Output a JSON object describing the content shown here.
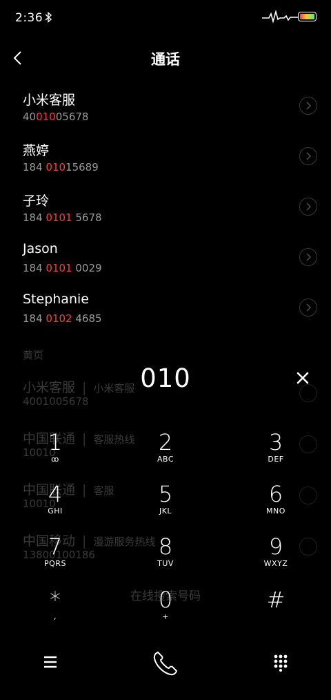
{
  "status_bar": {
    "time": "2:36"
  },
  "header": {
    "title": "通话"
  },
  "contacts": [
    {
      "name": "小米客服",
      "num_pre": "40",
      "num_hl": "010",
      "num_post": "05678"
    },
    {
      "name": "燕婷",
      "num_pre": "184 ",
      "num_hl": "010",
      "num_post": "15689"
    },
    {
      "name": "子玲",
      "num_pre": "184 ",
      "num_hl": "0101",
      "num_post": " 5678"
    },
    {
      "name": "Jason",
      "num_pre": "184 ",
      "num_hl": "0101",
      "num_post": " 0029"
    },
    {
      "name": "Stephanie",
      "num_pre": "184 ",
      "num_hl": "0102",
      "num_post": " 4685"
    }
  ],
  "yellow_pages": {
    "section_label": "黄页",
    "entries": [
      {
        "name": "小米客服",
        "sub": "小米客服",
        "number": "4001005678"
      },
      {
        "name": "中国联通",
        "sub": "客服热线",
        "number": "10010"
      },
      {
        "name": "中国联通",
        "sub": "客服",
        "number": "10010"
      },
      {
        "name": "中国移动",
        "sub": "漫游服务热线",
        "number": "13800100186"
      }
    ],
    "search_online": "在线搜索号码"
  },
  "dialer": {
    "input": "010",
    "keys": [
      {
        "digit": "1",
        "letters": "ꝏ"
      },
      {
        "digit": "2",
        "letters": "ABC"
      },
      {
        "digit": "3",
        "letters": "DEF"
      },
      {
        "digit": "4",
        "letters": "GHI"
      },
      {
        "digit": "5",
        "letters": "JKL"
      },
      {
        "digit": "6",
        "letters": "MNO"
      },
      {
        "digit": "7",
        "letters": "PQRS"
      },
      {
        "digit": "8",
        "letters": "TUV"
      },
      {
        "digit": "9",
        "letters": "WXYZ"
      },
      {
        "digit": "*",
        "letters": ","
      },
      {
        "digit": "0",
        "letters": "+"
      },
      {
        "digit": "#",
        "letters": ""
      }
    ]
  }
}
